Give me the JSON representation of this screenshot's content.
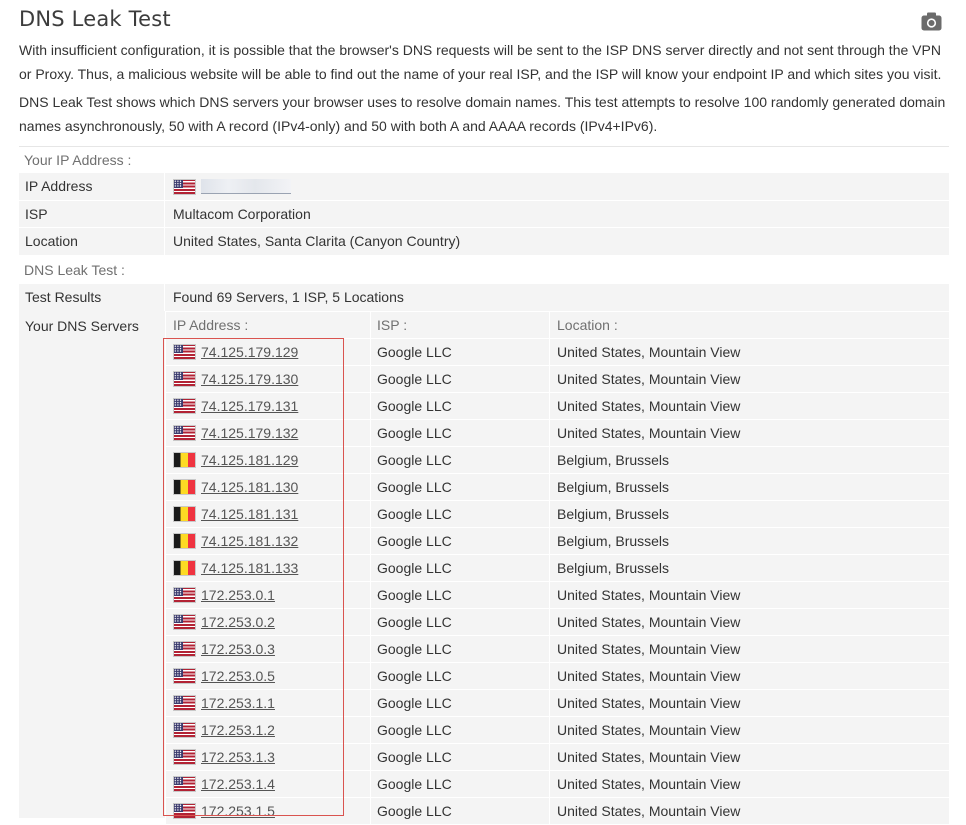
{
  "title": "DNS Leak Test",
  "icons": {
    "screenshot": "camera-icon"
  },
  "intro": [
    "With insufficient configuration, it is possible that the browser's DNS requests will be sent to the ISP DNS server directly and not sent through the VPN or Proxy. Thus, a malicious website will be able to find out the name of your real ISP, and the ISP will know your endpoint IP and which sites you visit.",
    "DNS Leak Test shows which DNS servers your browser uses to resolve domain names. This test attempts to resolve 100 randomly generated domain names asynchronously, 50 with A record (IPv4-only) and 50 with both A and AAAA records (IPv4+IPv6)."
  ],
  "your_ip": {
    "section_label": "Your IP Address :",
    "rows": [
      {
        "key": "IP Address",
        "value": "",
        "flag": "us",
        "redacted": true
      },
      {
        "key": "ISP",
        "value": "Multacom Corporation"
      },
      {
        "key": "Location",
        "value": "United States, Santa Clarita (Canyon Country)"
      }
    ]
  },
  "dns_test": {
    "section_label": "DNS Leak Test :",
    "results_key": "Test Results",
    "results_value": "Found 69 Servers, 1 ISP, 5 Locations",
    "servers_key": "Your DNS Servers",
    "columns": [
      "IP Address :",
      "ISP :",
      "Location :"
    ],
    "servers": [
      {
        "flag": "us",
        "ip": "74.125.179.129",
        "isp": "Google LLC",
        "location": "United States, Mountain View"
      },
      {
        "flag": "us",
        "ip": "74.125.179.130",
        "isp": "Google LLC",
        "location": "United States, Mountain View"
      },
      {
        "flag": "us",
        "ip": "74.125.179.131",
        "isp": "Google LLC",
        "location": "United States, Mountain View"
      },
      {
        "flag": "us",
        "ip": "74.125.179.132",
        "isp": "Google LLC",
        "location": "United States, Mountain View"
      },
      {
        "flag": "be",
        "ip": "74.125.181.129",
        "isp": "Google LLC",
        "location": "Belgium, Brussels"
      },
      {
        "flag": "be",
        "ip": "74.125.181.130",
        "isp": "Google LLC",
        "location": "Belgium, Brussels"
      },
      {
        "flag": "be",
        "ip": "74.125.181.131",
        "isp": "Google LLC",
        "location": "Belgium, Brussels"
      },
      {
        "flag": "be",
        "ip": "74.125.181.132",
        "isp": "Google LLC",
        "location": "Belgium, Brussels"
      },
      {
        "flag": "be",
        "ip": "74.125.181.133",
        "isp": "Google LLC",
        "location": "Belgium, Brussels"
      },
      {
        "flag": "us",
        "ip": "172.253.0.1",
        "isp": "Google LLC",
        "location": "United States, Mountain View"
      },
      {
        "flag": "us",
        "ip": "172.253.0.2",
        "isp": "Google LLC",
        "location": "United States, Mountain View"
      },
      {
        "flag": "us",
        "ip": "172.253.0.3",
        "isp": "Google LLC",
        "location": "United States, Mountain View"
      },
      {
        "flag": "us",
        "ip": "172.253.0.5",
        "isp": "Google LLC",
        "location": "United States, Mountain View"
      },
      {
        "flag": "us",
        "ip": "172.253.1.1",
        "isp": "Google LLC",
        "location": "United States, Mountain View"
      },
      {
        "flag": "us",
        "ip": "172.253.1.2",
        "isp": "Google LLC",
        "location": "United States, Mountain View"
      },
      {
        "flag": "us",
        "ip": "172.253.1.3",
        "isp": "Google LLC",
        "location": "United States, Mountain View"
      },
      {
        "flag": "us",
        "ip": "172.253.1.4",
        "isp": "Google LLC",
        "location": "United States, Mountain View"
      },
      {
        "flag": "us",
        "ip": "172.253.1.5",
        "isp": "Google LLC",
        "location": "United States, Mountain View"
      }
    ]
  },
  "colors": {
    "highlight_border": "#d9534f",
    "row_bg": "#f4f4f4",
    "label_grey": "#707070"
  }
}
